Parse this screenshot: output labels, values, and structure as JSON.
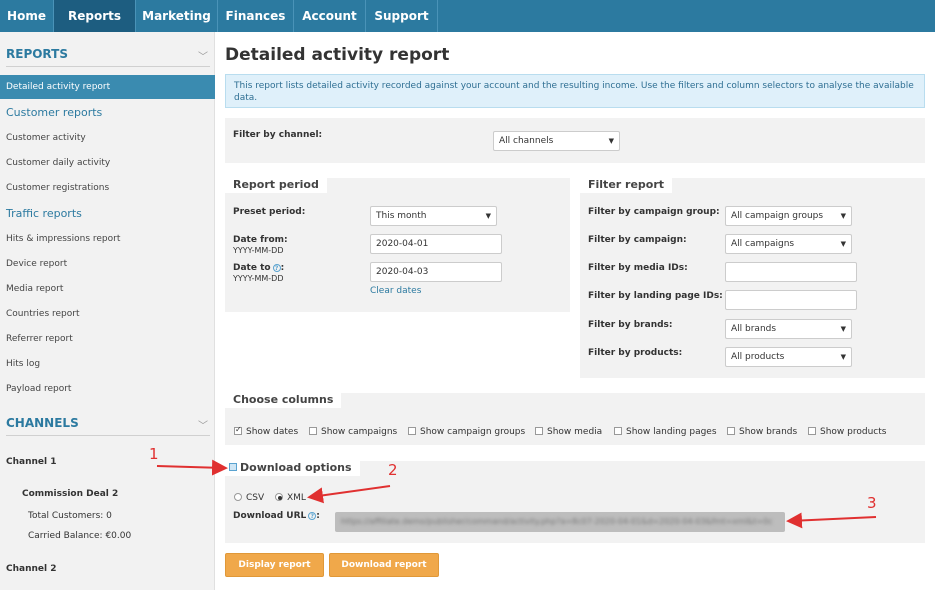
{
  "nav": {
    "tabs": [
      {
        "label": "Home"
      },
      {
        "label": "Reports"
      },
      {
        "label": "Marketing"
      },
      {
        "label": "Finances"
      },
      {
        "label": "Account"
      },
      {
        "label": "Support"
      }
    ],
    "active": "Reports"
  },
  "sidebar": {
    "reports_title": "REPORTS",
    "active_item": "Detailed activity report",
    "customer_group": "Customer reports",
    "customer_items": [
      "Customer activity",
      "Customer daily activity",
      "Customer registrations"
    ],
    "traffic_group": "Traffic reports",
    "traffic_items": [
      "Hits & impressions report",
      "Device report",
      "Media report",
      "Countries report",
      "Referrer report",
      "Hits log",
      "Payload report"
    ],
    "channels_title": "CHANNELS",
    "channel1": "Channel 1",
    "commission_deal": "Commission Deal 2",
    "total_customers": "Total Customers: 0",
    "carried_balance": "Carried Balance: €0.00",
    "channel2": "Channel 2"
  },
  "main": {
    "title": "Detailed activity report",
    "info": "This report lists detailed activity recorded against your account and the resulting income. Use the filters and column selectors to analyse the available data.",
    "filter_channel_label": "Filter by channel:",
    "filter_channel_value": "All channels",
    "period": {
      "title": "Report period",
      "preset_label": "Preset period:",
      "preset_value": "This month",
      "from_label": "Date from:",
      "from_format": "YYYY-MM-DD",
      "from_value": "2020-04-01",
      "to_label": "Date to",
      "to_format": "YYYY-MM-DD",
      "to_value": "2020-04-03",
      "clear": "Clear dates"
    },
    "filter": {
      "title": "Filter report",
      "campaign_group_label": "Filter by campaign group:",
      "campaign_group_value": "All campaign groups",
      "campaign_label": "Filter by campaign:",
      "campaign_value": "All campaigns",
      "media_label": "Filter by media IDs:",
      "landing_label": "Filter by landing page IDs:",
      "brands_label": "Filter by brands:",
      "brands_value": "All brands",
      "products_label": "Filter by products:",
      "products_value": "All products"
    },
    "columns": {
      "title": "Choose columns",
      "options": [
        {
          "label": "Show dates",
          "checked": true
        },
        {
          "label": "Show campaigns",
          "checked": false
        },
        {
          "label": "Show campaign groups",
          "checked": false
        },
        {
          "label": "Show media",
          "checked": false
        },
        {
          "label": "Show landing pages",
          "checked": false
        },
        {
          "label": "Show brands",
          "checked": false
        },
        {
          "label": "Show products",
          "checked": false
        }
      ]
    },
    "download": {
      "title": "Download options",
      "csv": "CSV",
      "xml": "XML",
      "selected": "XML",
      "url_label": "Download URL",
      "url_value": "https://affiliate.demo/publisher/command/activity.php?a=8c07-2020-04-01&d=2020-04-03&fmt=xml&t=0c"
    },
    "buttons": {
      "display": "Display report",
      "download": "Download report"
    }
  },
  "annotations": [
    "1",
    "2",
    "3"
  ],
  "colors": {
    "nav": "#2c7aa0",
    "nav_active": "#1d5d80",
    "button": "#f0a84a",
    "annotation": "#e03030"
  }
}
